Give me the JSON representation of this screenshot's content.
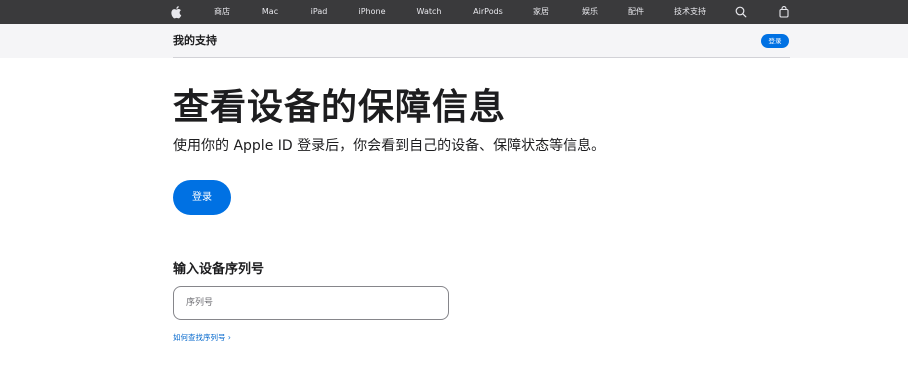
{
  "globalnav": {
    "items": [
      {
        "label": "",
        "icon": "apple-logo-icon"
      },
      {
        "label": "商店"
      },
      {
        "label": "Mac"
      },
      {
        "label": "iPad"
      },
      {
        "label": "iPhone"
      },
      {
        "label": "Watch"
      },
      {
        "label": "AirPods"
      },
      {
        "label": "家居"
      },
      {
        "label": "娱乐"
      },
      {
        "label": "配件"
      },
      {
        "label": "技术支持"
      },
      {
        "label": "",
        "icon": "search-icon"
      },
      {
        "label": "",
        "icon": "shopping-bag-icon"
      }
    ]
  },
  "subnav": {
    "title": "我的支持",
    "signin_label": "登录"
  },
  "hero": {
    "title": "查看设备的保障信息",
    "subtitle": "使用你的 Apple ID 登录后，你会看到自己的设备、保障状态等信息。",
    "signin_label": "登录"
  },
  "serial": {
    "heading": "输入设备序列号",
    "placeholder": "序列号",
    "help_link": "如何查找序列号 ›"
  },
  "colors": {
    "accent": "#0071e3",
    "nav_bg": "#3a3a3c",
    "link": "#0066cc"
  }
}
